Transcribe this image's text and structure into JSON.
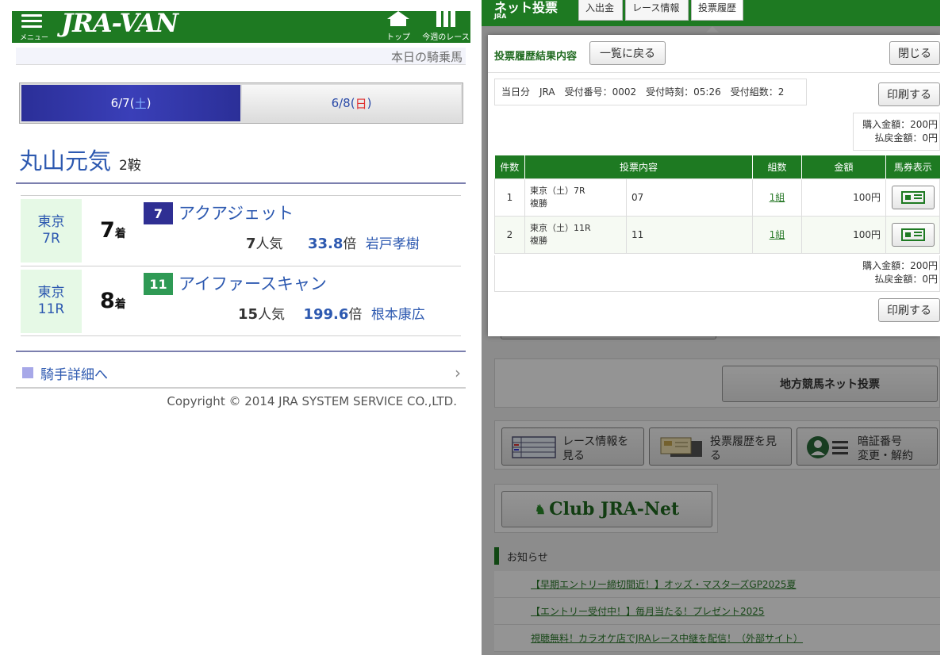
{
  "left": {
    "header": {
      "menu_label": "メニュー",
      "logo": "JRA-VAN",
      "top_label": "トップ",
      "week_label": "今週のレース"
    },
    "subtitle": "本日の騎乗馬",
    "date_tabs": [
      {
        "date": "6/7(",
        "day": "土",
        "close": ")"
      },
      {
        "date": "6/8(",
        "day": "日",
        "close": ")"
      }
    ],
    "jockey": {
      "name": "丸山元気",
      "rides": "2鞍"
    },
    "races": [
      {
        "venue": "東京",
        "race": "7R",
        "finish": "7",
        "finish_unit": "着",
        "horse_no": "7",
        "horse_no_color": "#2f2f93",
        "horse": "アクアジェット",
        "popularity": "7",
        "popularity_unit": "人気",
        "odds": "33.8",
        "odds_unit": "倍",
        "jockey": "岩戸孝樹"
      },
      {
        "venue": "東京",
        "race": "11R",
        "finish": "8",
        "finish_unit": "着",
        "horse_no": "11",
        "horse_no_color": "#2f9a55",
        "horse": "アイファースキャン",
        "popularity": "15",
        "popularity_unit": "人気",
        "odds": "199.6",
        "odds_unit": "倍",
        "jockey": "根本康広"
      }
    ],
    "detail_link": "騎手詳細へ",
    "copyright": "Copyright © 2014 JRA SYSTEM SERVICE CO.,LTD."
  },
  "right": {
    "header": {
      "brand": "ネット投票",
      "brand_sub": "JRA",
      "tabs": [
        "入出金",
        "レース情報",
        "投票履歴"
      ]
    },
    "modal": {
      "title": "投票履歴結果内容",
      "back_button": "一覧に戻る",
      "close_button": "閉じる",
      "info": "当日分　JRA　受付番号：0002　受付時刻：05:26　受付組数：2",
      "print_button": "印刷する",
      "purchase": "購入金額：200円",
      "payout": "払戻金額：0円",
      "columns": [
        "件数",
        "投票内容",
        "組数",
        "金額",
        "馬券表示"
      ],
      "rows": [
        {
          "no": "1",
          "race": "東京（土）7R",
          "bet_type": "複勝",
          "selection": "07",
          "sets": "1組",
          "amount": "100円"
        },
        {
          "no": "2",
          "race": "東京（土）11R",
          "bet_type": "複勝",
          "selection": "11",
          "sets": "1組",
          "amount": "100円"
        }
      ],
      "purchase2": "購入金額：200円",
      "payout2": "払戻金額：0円",
      "print_button2": "印刷する"
    },
    "chihou_button": "地方競馬ネット投票",
    "race_info_button": "レース情報を見る",
    "history_button": "投票履歴を見る",
    "pin_button_l1": "暗証番号",
    "pin_button_l2": "変更・解約",
    "club": "Club JRA-Net",
    "news_title": "お知らせ",
    "news": [
      "【早期エントリー締切間近！】オッズ・マスターズGP2025夏",
      "【エントリー受付中！】毎月当たる！プレゼント2025",
      "視聴無料！カラオケ店でJRAレース中継を配信！（外部サイト）"
    ]
  }
}
